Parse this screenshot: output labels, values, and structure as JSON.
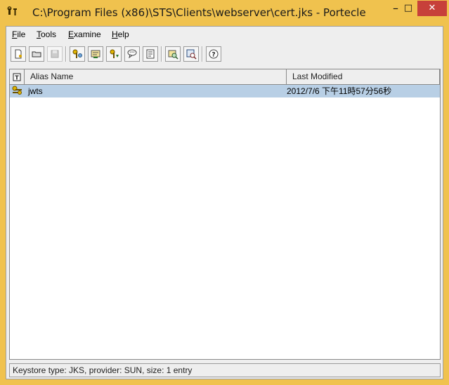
{
  "window": {
    "title": "C:\\Program Files (x86)\\STS\\Clients\\webserver\\cert.jks - Portecle",
    "app_icon": "keystore-app-icon",
    "controls": {
      "minimize": "–",
      "maximize": "□",
      "close": "✕"
    }
  },
  "menu": {
    "items": [
      {
        "label": "File",
        "mnemonic": "F",
        "rest": "ile"
      },
      {
        "label": "Tools",
        "mnemonic": "T",
        "rest": "ools"
      },
      {
        "label": "Examine",
        "mnemonic": "E",
        "rest": "xamine"
      },
      {
        "label": "Help",
        "mnemonic": "H",
        "rest": "elp"
      }
    ]
  },
  "toolbar": {
    "buttons": [
      {
        "name": "new-keystore-icon",
        "enabled": true
      },
      {
        "name": "open-keystore-icon",
        "enabled": true
      },
      {
        "name": "save-keystore-icon",
        "enabled": false
      },
      {
        "name": "generate-key-pair-icon",
        "enabled": true
      },
      {
        "name": "import-trusted-certificate-icon",
        "enabled": true
      },
      {
        "name": "import-key-pair-icon",
        "enabled": true
      },
      {
        "name": "set-keystore-password-icon",
        "enabled": true
      },
      {
        "name": "keystore-report-icon",
        "enabled": true
      },
      {
        "name": "examine-certificate-icon",
        "enabled": true
      },
      {
        "name": "examine-ssl-certificate-icon",
        "enabled": true
      },
      {
        "name": "help-icon",
        "enabled": true
      }
    ]
  },
  "table": {
    "columns": [
      {
        "label": "",
        "icon": "entry-type-column-icon"
      },
      {
        "label": "Alias Name"
      },
      {
        "label": "Last Modified"
      }
    ],
    "rows": [
      {
        "type_icon": "key-pair-entry-icon",
        "alias": "jwts",
        "last_modified": "2012/7/6 下午11時57分56秒",
        "selected": true
      }
    ]
  },
  "status": {
    "text": "Keystore type: JKS, provider: SUN, size: 1 entry"
  },
  "colors": {
    "title_bar": "#f0c24e",
    "close_button": "#c7403a",
    "selection": "#b8cfe5"
  }
}
